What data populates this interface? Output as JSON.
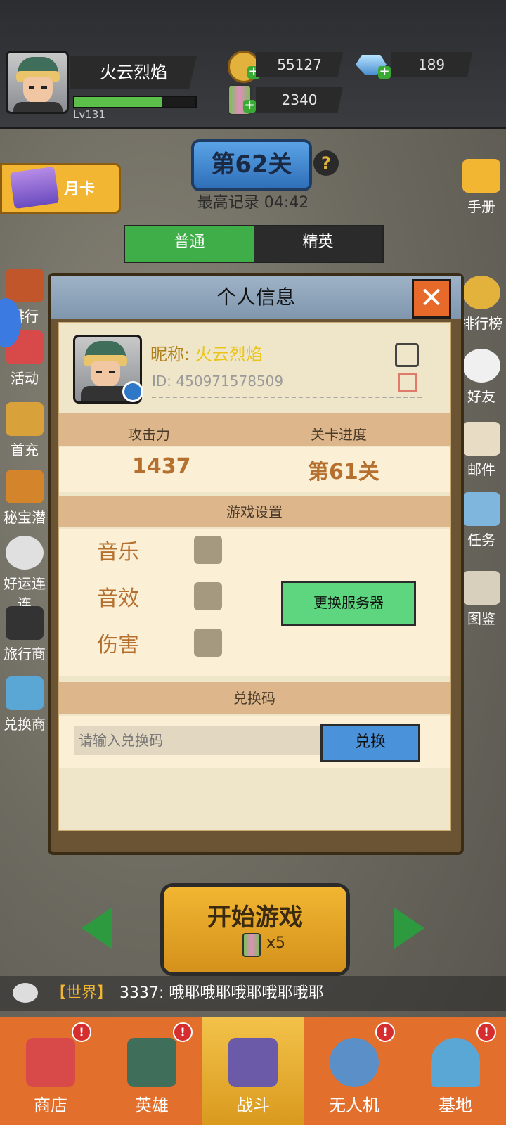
{
  "player": {
    "name": "火云烈焰",
    "level": "Lv131",
    "xp_fraction": 0.72
  },
  "resources": {
    "gold": "55127",
    "gems": "189",
    "energy": "2340"
  },
  "stage": {
    "title": "第62关",
    "help": "?",
    "record": "最高记录 04:42"
  },
  "mode_tabs": [
    {
      "label": "普通",
      "active": true
    },
    {
      "label": "精英",
      "active": false
    }
  ],
  "month_card": "月卡",
  "left_menu": [
    "排行",
    "活动",
    "首充",
    "秘宝潜",
    "好运连连",
    "旅行商",
    "兑换商"
  ],
  "right_menu": [
    "手册",
    "排行榜",
    "好友",
    "邮件",
    "任务",
    "图鉴"
  ],
  "modal": {
    "title": "个人信息",
    "close": "✕",
    "nickname_label": "昵称:",
    "nickname": "火云烈焰",
    "id_text": "ID: 450971578509",
    "stats": {
      "attack_label": "攻击力",
      "attack_value": "1437",
      "progress_label": "关卡进度",
      "progress_value": "第61关"
    },
    "settings": {
      "header": "游戏设置",
      "music": "音乐",
      "sfx": "音效",
      "damage": "伤害",
      "server_button": "更换服务器"
    },
    "redeem": {
      "header": "兑换码",
      "placeholder": "请输入兑换码",
      "button": "兑换"
    }
  },
  "start": {
    "label": "开始游戏",
    "cost": "x5"
  },
  "chat": {
    "channel": "【世界】",
    "message": "3337: 哦耶哦耶哦耶哦耶哦耶"
  },
  "navbar": [
    {
      "label": "商店",
      "badge": "!"
    },
    {
      "label": "英雄",
      "badge": "!"
    },
    {
      "label": "战斗",
      "badge": ""
    },
    {
      "label": "无人机",
      "badge": "!"
    },
    {
      "label": "基地",
      "badge": "!"
    }
  ],
  "colors": {
    "accent": "#e26f2c",
    "active_tab": "#3fae49",
    "gold": "#f2b632"
  }
}
